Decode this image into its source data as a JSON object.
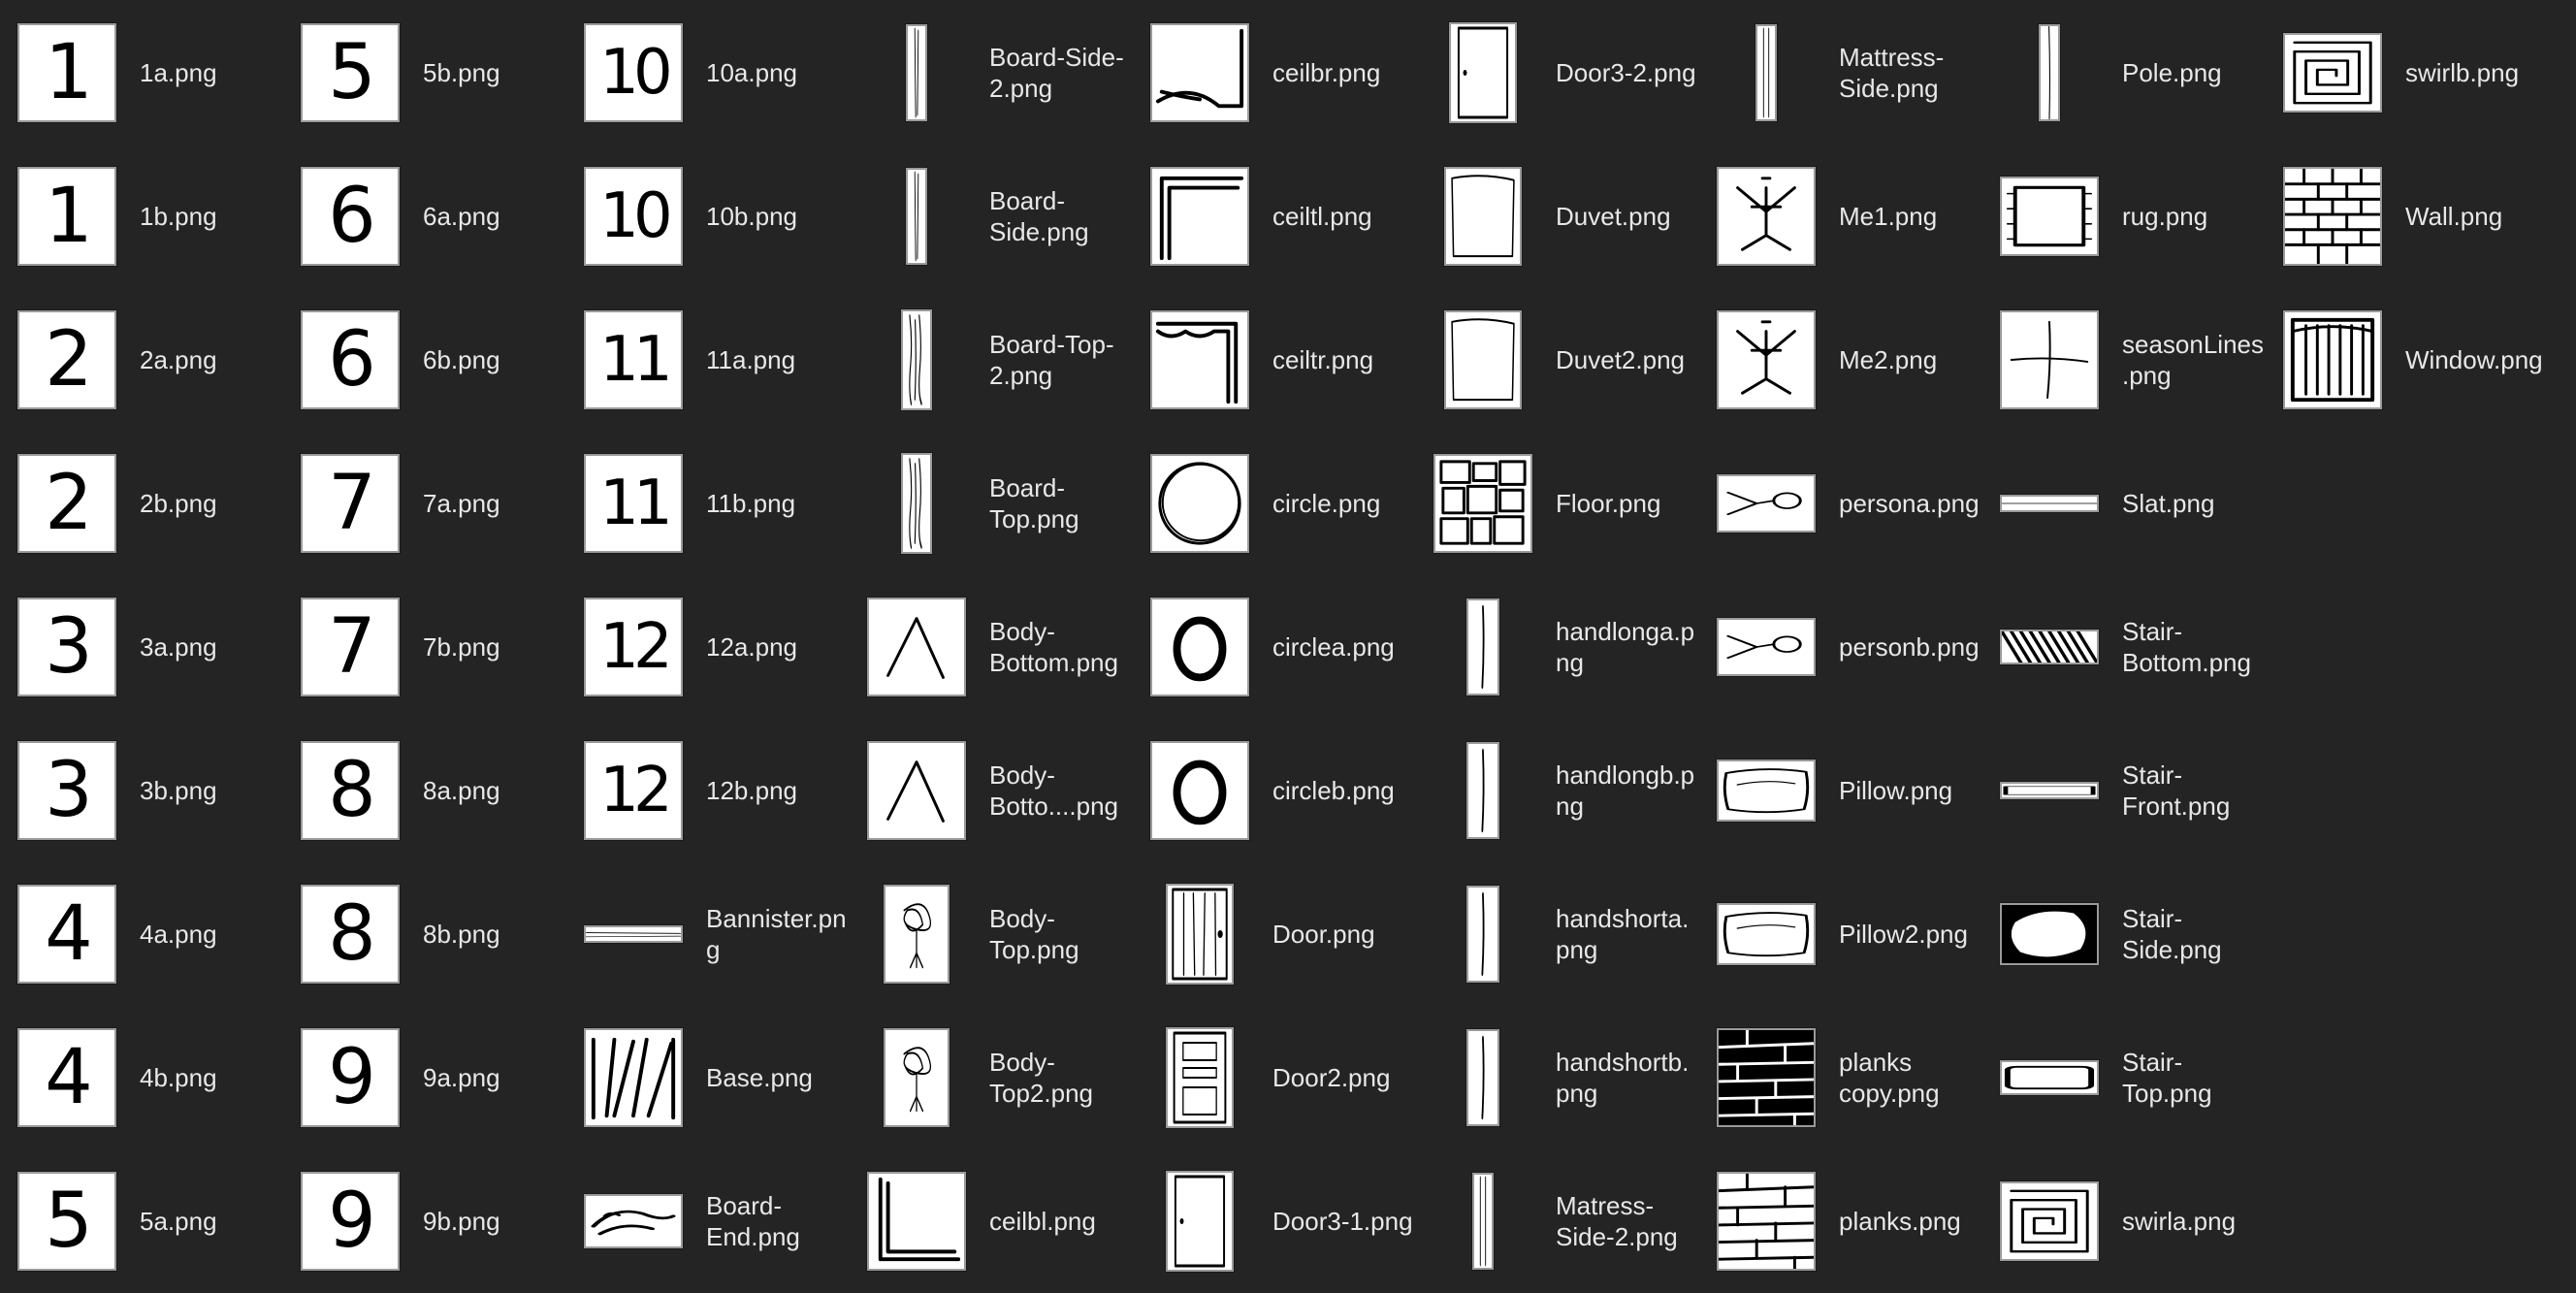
{
  "files": [
    {
      "name": "1a.png",
      "thumb": "digit",
      "glyph": "1"
    },
    {
      "name": "1b.png",
      "thumb": "digit",
      "glyph": "1"
    },
    {
      "name": "2a.png",
      "thumb": "digit",
      "glyph": "2"
    },
    {
      "name": "2b.png",
      "thumb": "digit",
      "glyph": "2"
    },
    {
      "name": "3a.png",
      "thumb": "digit",
      "glyph": "3"
    },
    {
      "name": "3b.png",
      "thumb": "digit",
      "glyph": "3"
    },
    {
      "name": "4a.png",
      "thumb": "digit",
      "glyph": "4"
    },
    {
      "name": "4b.png",
      "thumb": "digit",
      "glyph": "4"
    },
    {
      "name": "5a.png",
      "thumb": "digit",
      "glyph": "5"
    },
    {
      "name": "5b.png",
      "thumb": "digit",
      "glyph": "5"
    },
    {
      "name": "6a.png",
      "thumb": "digit",
      "glyph": "6"
    },
    {
      "name": "6b.png",
      "thumb": "digit",
      "glyph": "6"
    },
    {
      "name": "7a.png",
      "thumb": "digit",
      "glyph": "7"
    },
    {
      "name": "7b.png",
      "thumb": "digit",
      "glyph": "7"
    },
    {
      "name": "8a.png",
      "thumb": "digit",
      "glyph": "8"
    },
    {
      "name": "8b.png",
      "thumb": "digit",
      "glyph": "8"
    },
    {
      "name": "9a.png",
      "thumb": "digit",
      "glyph": "9"
    },
    {
      "name": "9b.png",
      "thumb": "digit",
      "glyph": "9"
    },
    {
      "name": "10a.png",
      "thumb": "digit",
      "glyph": "10"
    },
    {
      "name": "10b.png",
      "thumb": "digit",
      "glyph": "10"
    },
    {
      "name": "11a.png",
      "thumb": "digit",
      "glyph": "11"
    },
    {
      "name": "11b.png",
      "thumb": "digit",
      "glyph": "11"
    },
    {
      "name": "12a.png",
      "thumb": "digit",
      "glyph": "12"
    },
    {
      "name": "12b.png",
      "thumb": "digit",
      "glyph": "12"
    },
    {
      "name": "Bannister.png",
      "thumb": "bannister"
    },
    {
      "name": "Base.png",
      "thumb": "base"
    },
    {
      "name": "Board-End.png",
      "thumb": "board-end"
    },
    {
      "name": "Board-Side-2.png",
      "thumb": "board-side"
    },
    {
      "name": "Board-Side.png",
      "thumb": "board-side"
    },
    {
      "name": "Board-Top-2.png",
      "thumb": "board-top"
    },
    {
      "name": "Board-Top.png",
      "thumb": "board-top"
    },
    {
      "name": "Body-Bottom.png",
      "thumb": "body-bottom"
    },
    {
      "name": "Body-Botto....png",
      "thumb": "body-bottom"
    },
    {
      "name": "Body-Top.png",
      "thumb": "body-top"
    },
    {
      "name": "Body-Top2.png",
      "thumb": "body-top"
    },
    {
      "name": "ceilbl.png",
      "thumb": "ceilbl"
    },
    {
      "name": "ceilbr.png",
      "thumb": "ceilbr"
    },
    {
      "name": "ceiltl.png",
      "thumb": "ceiltl"
    },
    {
      "name": "ceiltr.png",
      "thumb": "ceiltr"
    },
    {
      "name": "circle.png",
      "thumb": "circle"
    },
    {
      "name": "circlea.png",
      "thumb": "circle-small"
    },
    {
      "name": "circleb.png",
      "thumb": "circle-small"
    },
    {
      "name": "Door.png",
      "thumb": "door-wood"
    },
    {
      "name": "Door2.png",
      "thumb": "door-panel"
    },
    {
      "name": "Door3-1.png",
      "thumb": "door-plain"
    },
    {
      "name": "Door3-2.png",
      "thumb": "door-plain"
    },
    {
      "name": "Duvet.png",
      "thumb": "duvet"
    },
    {
      "name": "Duvet2.png",
      "thumb": "duvet"
    },
    {
      "name": "Floor.png",
      "thumb": "floor"
    },
    {
      "name": "handlonga.png",
      "thumb": "handle"
    },
    {
      "name": "handlongb.png",
      "thumb": "handle"
    },
    {
      "name": "handshorta.png",
      "thumb": "handle"
    },
    {
      "name": "handshortb.png",
      "thumb": "handle"
    },
    {
      "name": "Matress-Side-2.png",
      "thumb": "matress"
    },
    {
      "name": "Mattress-Side.png",
      "thumb": "matress"
    },
    {
      "name": "Me1.png",
      "thumb": "me"
    },
    {
      "name": "Me2.png",
      "thumb": "me"
    },
    {
      "name": "persona.png",
      "thumb": "person"
    },
    {
      "name": "personb.png",
      "thumb": "person"
    },
    {
      "name": "Pillow.png",
      "thumb": "pillow"
    },
    {
      "name": "Pillow2.png",
      "thumb": "pillow"
    },
    {
      "name": "planks copy.png",
      "thumb": "planks-dark"
    },
    {
      "name": "planks.png",
      "thumb": "planks"
    },
    {
      "name": "Pole.png",
      "thumb": "pole"
    },
    {
      "name": "rug.png",
      "thumb": "rug"
    },
    {
      "name": "seasonLines.png",
      "thumb": "season"
    },
    {
      "name": "Slat.png",
      "thumb": "slat"
    },
    {
      "name": "Stair-Bottom.png",
      "thumb": "stair-bottom"
    },
    {
      "name": "Stair-Front.png",
      "thumb": "stair-front"
    },
    {
      "name": "Stair-Side.png",
      "thumb": "stair-side"
    },
    {
      "name": "Stair-Top.png",
      "thumb": "stair-top"
    },
    {
      "name": "swirla.png",
      "thumb": "swirl"
    },
    {
      "name": "swirlb.png",
      "thumb": "swirl"
    },
    {
      "name": "Wall.png",
      "thumb": "wall"
    },
    {
      "name": "Window.png",
      "thumb": "window"
    }
  ]
}
